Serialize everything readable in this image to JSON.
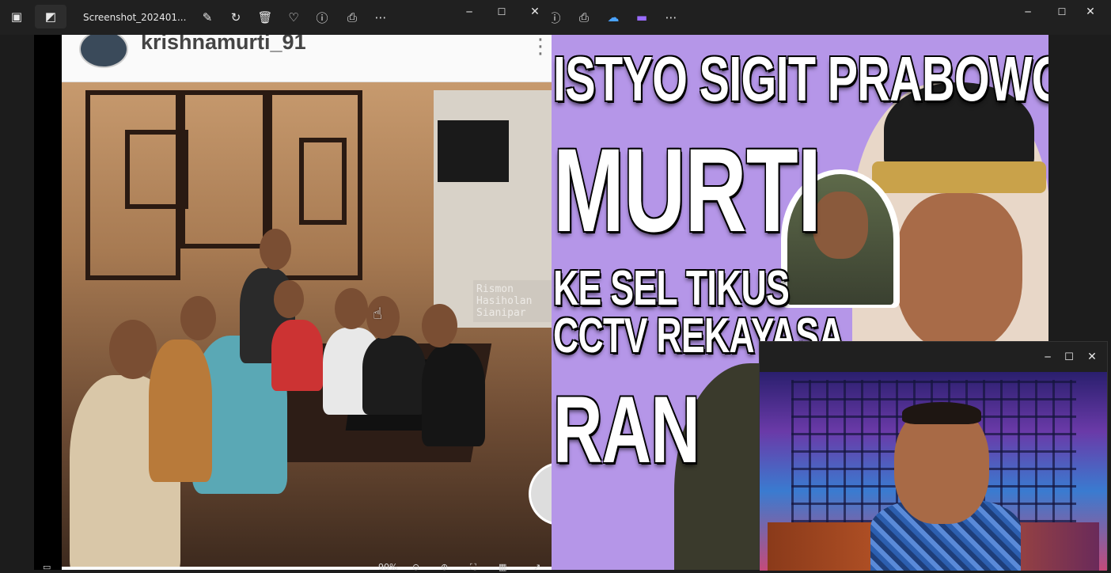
{
  "front_window": {
    "title": "Screenshot_202401...",
    "toolbar_icons": [
      "gallery-icon",
      "edit-image-icon",
      "edit-icon",
      "rotate-icon",
      "delete-icon",
      "favorite-icon",
      "info-icon",
      "print-icon",
      "more-icon"
    ],
    "minimize": "─",
    "maximize": "☐",
    "close": "✕",
    "instagram": {
      "username": "krishnamurti_91",
      "menu": "⋮",
      "watermark": "Rismon Hasiholan Sianipar"
    },
    "status_bar": {
      "zoom": "90%"
    }
  },
  "back_window": {
    "toolbar_icons": [
      "info-icon",
      "print-icon",
      "onedrive-icon",
      "clipchamp-icon",
      "more-icon"
    ],
    "minimize": "─",
    "maximize": "☐",
    "close": "✕",
    "poster": {
      "line1": "ISTYO SIGIT PRABOWO",
      "line2": "MURTI",
      "line3": "KE SEL TIKUS",
      "line4": "CCTV REKAYASA",
      "line5": "RAN"
    }
  },
  "cam_window": {
    "minimize": "─",
    "maximize": "☐",
    "close": "✕"
  },
  "colors": {
    "poster_bg": "#b596e8",
    "titlebar": "#202020"
  }
}
